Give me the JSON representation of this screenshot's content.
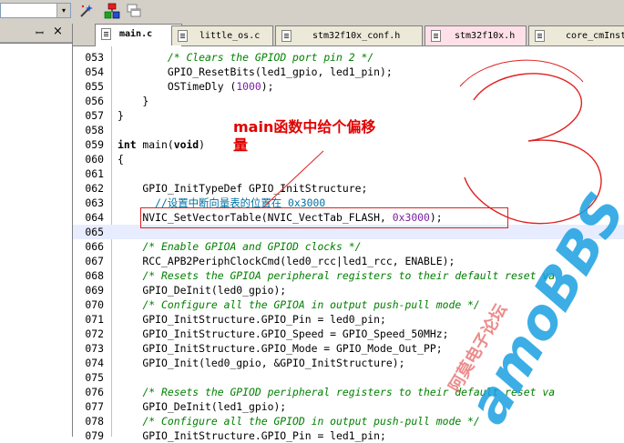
{
  "toolbar": {
    "combo_value": "",
    "combo_arrow": "▾",
    "icons": [
      "magic-wand-icon",
      "config-icon",
      "windows-icon"
    ]
  },
  "left_pane": {
    "pin_glyph": "ꟷ",
    "close_glyph": "×"
  },
  "tabs": [
    {
      "label": "main.c",
      "active": true
    },
    {
      "label": "little_os.c",
      "active": false
    },
    {
      "label": "stm32f10x_conf.h",
      "active": false
    },
    {
      "label": "stm32f10x.h",
      "active": false
    },
    {
      "label": "core_cmInst",
      "active": false
    }
  ],
  "code_lines": [
    {
      "n": "053",
      "html": "        <span class='cmt'>/* Clears the GPIOD port pin 2 */</span>"
    },
    {
      "n": "054",
      "html": "        GPIO_ResetBits(led1_gpio, led1_pin);"
    },
    {
      "n": "055",
      "html": "        OSTimeDly (<span class='num'>1000</span>);"
    },
    {
      "n": "056",
      "html": "    }"
    },
    {
      "n": "057",
      "html": "}"
    },
    {
      "n": "058",
      "html": ""
    },
    {
      "n": "059",
      "html": "<span class='kw'>int</span> main(<span class='kw'>void</span>)"
    },
    {
      "n": "060",
      "html": "{"
    },
    {
      "n": "061",
      "html": ""
    },
    {
      "n": "062",
      "html": "    GPIO_InitTypeDef GPIO_InitStructure;"
    },
    {
      "n": "063",
      "html": "      <span class='cmt-cn'>//设置中断向量表的位置在 0x3000</span>"
    },
    {
      "n": "064",
      "html": "    NVIC_SetVectorTable(NVIC_VectTab_FLASH, <span class='num'>0x3000</span>);"
    },
    {
      "n": "065",
      "html": ""
    },
    {
      "n": "066",
      "html": "    <span class='cmt'>/* Enable GPIOA and GPIOD clocks */</span>"
    },
    {
      "n": "067",
      "html": "    RCC_APB2PeriphClockCmd(led0_rcc|led1_rcc, ENABLE);"
    },
    {
      "n": "068",
      "html": "    <span class='cmt'>/* Resets the GPIOA peripheral registers to their default reset va</span>"
    },
    {
      "n": "069",
      "html": "    GPIO_DeInit(led0_gpio);"
    },
    {
      "n": "070",
      "html": "    <span class='cmt'>/* Configure all the GPIOA in output push-pull mode */</span>"
    },
    {
      "n": "071",
      "html": "    GPIO_InitStructure.GPIO_Pin = led0_pin;"
    },
    {
      "n": "072",
      "html": "    GPIO_InitStructure.GPIO_Speed = GPIO_Speed_50MHz;"
    },
    {
      "n": "073",
      "html": "    GPIO_InitStructure.GPIO_Mode = GPIO_Mode_Out_PP;"
    },
    {
      "n": "074",
      "html": "    GPIO_Init(led0_gpio, &amp;GPIO_InitStructure);"
    },
    {
      "n": "075",
      "html": ""
    },
    {
      "n": "076",
      "html": "    <span class='cmt'>/* Resets the GPIOD peripheral registers to their default reset va</span>"
    },
    {
      "n": "077",
      "html": "    GPIO_DeInit(led1_gpio);"
    },
    {
      "n": "078",
      "html": "    <span class='cmt'>/* Configure all the GPIOD in output push-pull mode */</span>"
    },
    {
      "n": "079",
      "html": "    GPIO_InitStructure.GPIO_Pin = led1_pin;"
    }
  ],
  "current_line": "065",
  "annotation": {
    "text_line1": "main函数中给个偏移",
    "text_line2": "量",
    "color": "#e00000"
  },
  "watermark": {
    "brand": "amoBBS",
    "chinese": "阿莫电子论坛",
    "color": "#1aa0e0"
  },
  "colors": {
    "comment": "#008000",
    "number": "#7a1fa2",
    "chinese_comment": "#0070a0",
    "current_line_bg": "#e8ecff"
  }
}
